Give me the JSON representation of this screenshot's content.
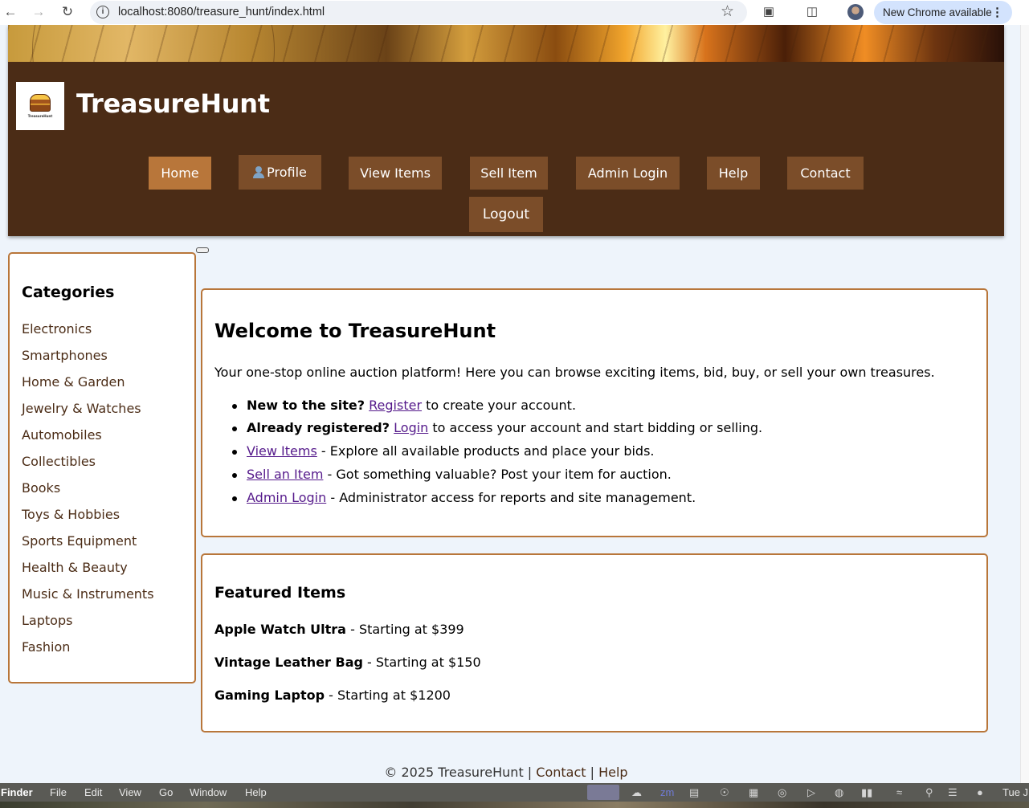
{
  "browser": {
    "url": "localhost:8080/treasure_hunt/index.html",
    "update_label": "New Chrome available"
  },
  "header": {
    "logo_text": "TreasureHunt",
    "title": "TreasureHunt"
  },
  "nav": {
    "home": "Home",
    "profile": "Profile",
    "view_items": "View Items",
    "sell_item": "Sell Item",
    "admin_login": "Admin Login",
    "help": "Help",
    "contact": "Contact",
    "logout": "Logout"
  },
  "sidebar": {
    "title": "Categories",
    "items": [
      "Electronics",
      "Smartphones",
      "Home & Garden",
      "Jewelry & Watches",
      "Automobiles",
      "Collectibles",
      "Books",
      "Toys & Hobbies",
      "Sports Equipment",
      "Health & Beauty",
      "Music & Instruments",
      "Laptops",
      "Fashion"
    ]
  },
  "welcome": {
    "heading": "Welcome to TreasureHunt",
    "intro": "Your one-stop online auction platform! Here you can browse exciting items, bid, buy, or sell your own treasures.",
    "b1_bold": "New to the site?",
    "b1_link": "Register",
    "b1_rest": "to create your account.",
    "b2_bold": "Already registered?",
    "b2_link": "Login",
    "b2_rest": "to access your account and start bidding or selling.",
    "b3_link": "View Items",
    "b3_rest": "- Explore all available products and place your bids.",
    "b4_link": "Sell an Item",
    "b4_rest": "- Got something valuable? Post your item for auction.",
    "b5_link": "Admin Login",
    "b5_rest": "- Administrator access for reports and site management."
  },
  "featured": {
    "heading": "Featured Items",
    "items": [
      {
        "name": "Apple Watch Ultra",
        "price": "- Starting at $399"
      },
      {
        "name": "Vintage Leather Bag",
        "price": "- Starting at $150"
      },
      {
        "name": "Gaming Laptop",
        "price": "- Starting at $1200"
      }
    ]
  },
  "footer": {
    "copyright": "© 2025 TreasureHunt |",
    "contact": "Contact",
    "sep": "|",
    "help": "Help"
  },
  "menubar": {
    "finder": "Finder",
    "file": "File",
    "edit": "Edit",
    "view": "View",
    "go": "Go",
    "window": "Window",
    "help": "Help",
    "clock": "Tue J"
  }
}
